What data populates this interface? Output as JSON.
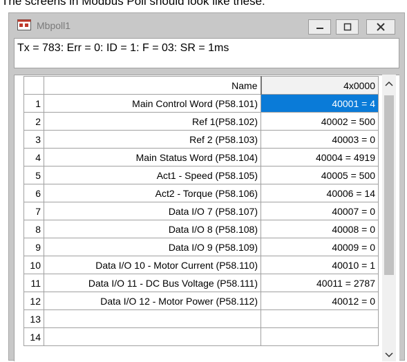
{
  "caption": "The screens in Modbus Poll should look like these:",
  "window": {
    "title": "Mbpoll1"
  },
  "status_line": "Tx = 783: Err = 0: ID = 1: F = 03: SR = 1ms",
  "grid": {
    "header_name": "Name",
    "header_value": "4x0000",
    "rows": [
      {
        "num": "1",
        "name": "Main Control Word (P58.101)",
        "value": "40001 = 4"
      },
      {
        "num": "2",
        "name": "Ref 1(P58.102)",
        "value": "40002 = 500"
      },
      {
        "num": "3",
        "name": "Ref 2 (P58.103)",
        "value": "40003 = 0"
      },
      {
        "num": "4",
        "name": "Main Status Word (P58.104)",
        "value": "40004 = 4919"
      },
      {
        "num": "5",
        "name": "Act1 - Speed (P58.105)",
        "value": "40005 = 500"
      },
      {
        "num": "6",
        "name": "Act2 - Torque (P58.106)",
        "value": "40006 = 14"
      },
      {
        "num": "7",
        "name": "Data I/O 7 (P58.107)",
        "value": "40007 = 0"
      },
      {
        "num": "8",
        "name": "Data I/O 8 (P58.108)",
        "value": "40008 = 0"
      },
      {
        "num": "9",
        "name": "Data I/O 9 (P58.109)",
        "value": "40009 = 0"
      },
      {
        "num": "10",
        "name": "Data I/O 10 - Motor Current (P58.110)",
        "value": "40010 = 1"
      },
      {
        "num": "11",
        "name": "Data I/O 11 - DC Bus Voltage (P58.111)",
        "value": "40011 = 2787"
      },
      {
        "num": "12",
        "name": "Data I/O 12 - Motor Power (P58.112)",
        "value": "40012 = 0"
      },
      {
        "num": "13",
        "name": "",
        "value": ""
      },
      {
        "num": "14",
        "name": "",
        "value": ""
      }
    ]
  },
  "colors": {
    "selection": "#0a7bd8"
  },
  "icons": {
    "app": "mbpoll-app-icon",
    "minimize": "minimize-icon",
    "maximize": "maximize-icon",
    "close": "close-icon"
  }
}
